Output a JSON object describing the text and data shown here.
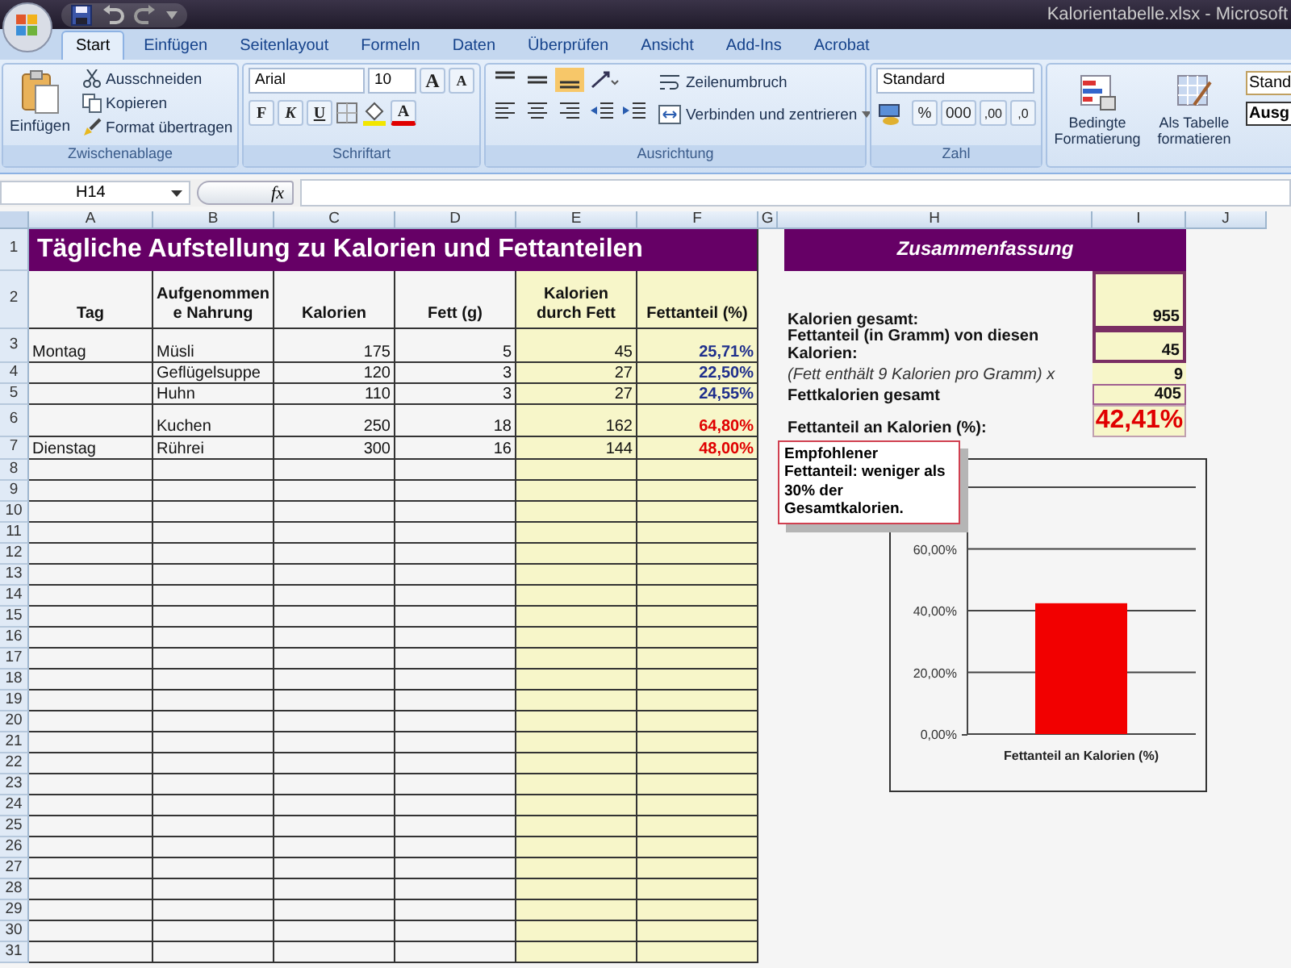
{
  "window": {
    "title": "Kalorientabelle.xlsx - Microsoft"
  },
  "tabs": [
    {
      "label": "Start",
      "selected": true
    },
    {
      "label": "Einfügen",
      "selected": false
    },
    {
      "label": "Seitenlayout",
      "selected": false
    },
    {
      "label": "Formeln",
      "selected": false
    },
    {
      "label": "Daten",
      "selected": false
    },
    {
      "label": "Überprüfen",
      "selected": false
    },
    {
      "label": "Ansicht",
      "selected": false
    },
    {
      "label": "Add-Ins",
      "selected": false
    },
    {
      "label": "Acrobat",
      "selected": false
    }
  ],
  "clipboard": {
    "paste": "Einfügen",
    "items": [
      "Ausschneiden",
      "Kopieren",
      "Format übertragen"
    ],
    "label": "Zwischenablage"
  },
  "font": {
    "name": "Arial",
    "size": "10",
    "grow": "A",
    "shrink": "A",
    "bold": "F",
    "italic": "K",
    "underline": "U",
    "font_color_letter": "A",
    "label": "Schriftart"
  },
  "alignment": {
    "vertical": [
      {
        "selected": false
      },
      {
        "selected": false
      },
      {
        "selected": true
      }
    ],
    "wrap": "Zeilenumbruch",
    "merge": "Verbinden und zentrieren",
    "label": "Ausrichtung"
  },
  "number": {
    "format": "Standard",
    "percent": "%",
    "thousands": "000",
    "increase_decimal": ",00",
    "decrease_decimal": ",0",
    "label": "Zahl"
  },
  "styles": {
    "items": [
      "Bedingte Formatierung",
      "Als Tabelle formatieren"
    ],
    "style_1": "Stand",
    "style_2": "Ausg"
  },
  "formula_bar": {
    "name_box": "H14",
    "function_label": "fx"
  },
  "sheet": {
    "columns": [
      "A",
      "B",
      "C",
      "D",
      "E",
      "F",
      "G",
      "H",
      "I",
      "J"
    ],
    "row_numbers": [
      "1",
      "2",
      "3",
      "4",
      "5",
      "6",
      "7",
      "8",
      "9",
      "10",
      "11",
      "12",
      "13",
      "14",
      "15",
      "16",
      "17",
      "18",
      "19",
      "20",
      "21",
      "22",
      "23",
      "24",
      "25",
      "26",
      "27",
      "28",
      "29",
      "30",
      "31"
    ]
  },
  "table": {
    "title": "Tägliche Aufstellung zu Kalorien und Fettanteilen",
    "headers": [
      "Tag",
      "Aufgenommene Nahrung",
      "Kalorien",
      "Fett (g)",
      "Kalorien durch Fett",
      "Fettanteil (%)"
    ],
    "rows": [
      {
        "cells": [
          "Montag",
          "Müsli",
          "175",
          "5",
          "45",
          "25,71%"
        ],
        "warning": false
      },
      {
        "cells": [
          "",
          "Geflügelsuppe",
          "120",
          "3",
          "27",
          "22,50%"
        ],
        "warning": false
      },
      {
        "cells": [
          "",
          "Huhn",
          "110",
          "3",
          "27",
          "24,55%"
        ],
        "warning": false
      },
      {
        "cells": [
          "",
          "Kuchen",
          "250",
          "18",
          "162",
          "64,80%"
        ],
        "warning": true
      },
      {
        "cells": [
          "Dienstag",
          "Rührei",
          "300",
          "16",
          "144",
          "48,00%"
        ],
        "warning": true
      }
    ]
  },
  "summary": {
    "title": "Zusammenfassung",
    "rows": [
      {
        "label": "Kalorien gesamt:",
        "value": "955",
        "kind": "input"
      },
      {
        "label": "Fettanteil (in Gramm) von diesen Kalorien:",
        "value": "45",
        "kind": "input"
      },
      {
        "label": "(Fett enthält 9 Kalorien pro Gramm) x",
        "value": "9",
        "kind": "factor"
      },
      {
        "label": "Fettkalorien gesamt",
        "value": "405",
        "kind": "total"
      },
      {
        "label": "Fettanteil an Kalorien (%):",
        "value": "42,41%",
        "kind": "result"
      }
    ]
  },
  "callout": {
    "text": "Empfohlener Fettanteil: weniger als 30% der Gesamtkalorien."
  },
  "chart": {
    "chart_data": {
      "type": "bar",
      "categories": [
        "Fettanteil an Kalorien (%)"
      ],
      "values": [
        42.4
      ],
      "ylim": [
        0,
        80
      ],
      "grid": true,
      "yticks": [
        {
          "value": 0,
          "label": "0,00%"
        },
        {
          "value": 20,
          "label": "20,00%"
        },
        {
          "value": 40,
          "label": "40,00%"
        },
        {
          "value": 60,
          "label": "60,00%"
        }
      ]
    }
  }
}
